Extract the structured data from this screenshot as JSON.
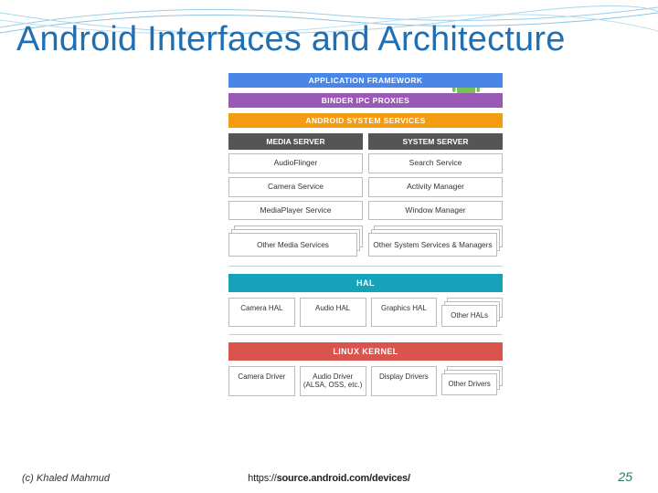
{
  "title": "Android Interfaces and Architecture",
  "icon": "android-icon",
  "layers": {
    "app_framework": "APPLICATION FRAMEWORK",
    "binder_ipc": "BINDER IPC PROXIES",
    "system_services": "ANDROID SYSTEM SERVICES",
    "hal": "HAL",
    "linux_kernel": "LINUX KERNEL"
  },
  "servers": {
    "media": {
      "header": "MEDIA SERVER",
      "items": [
        "AudioFlinger",
        "Camera Service",
        "MediaPlayer Service"
      ],
      "more": "Other Media Services"
    },
    "system": {
      "header": "SYSTEM SERVER",
      "items": [
        "Search Service",
        "Activity Manager",
        "Window Manager"
      ],
      "more": "Other System Services & Managers"
    }
  },
  "hal_row": {
    "items": [
      "Camera HAL",
      "Audio HAL",
      "Graphics HAL"
    ],
    "more": "Other HALs"
  },
  "kernel_row": {
    "items": [
      "Camera Driver",
      "Audio Driver (ALSA, OSS, etc.)",
      "Display Drivers"
    ],
    "more": "Other Drivers"
  },
  "footer": {
    "copyright": "(c) Khaled Mahmud",
    "source_url": "https://source.android.com/devices/",
    "page_number": "25"
  },
  "colors": {
    "title": "#1f6fb2",
    "app_framework": "#4a86e8",
    "binder_ipc": "#9b59b6",
    "system_services": "#f39c12",
    "hal": "#16a2b8",
    "linux_kernel": "#d9534f",
    "pagenum": "#2a7c5b"
  }
}
